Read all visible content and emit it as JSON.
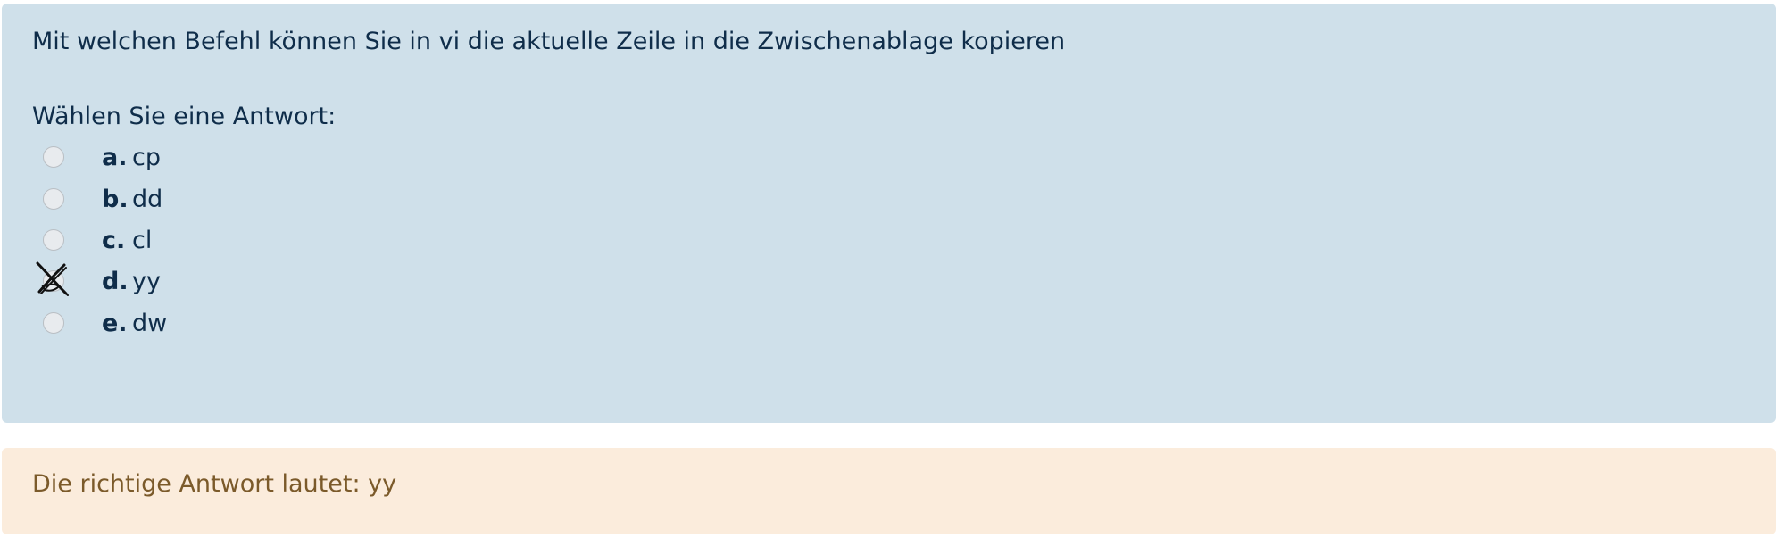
{
  "question": {
    "text": "Mit welchen Befehl können Sie in vi die aktuelle Zeile in die Zwischenablage kopieren",
    "prompt": "Wählen Sie eine Antwort:",
    "options": [
      {
        "letter": "a.",
        "text": "cp",
        "selected": false
      },
      {
        "letter": "b.",
        "text": "dd",
        "selected": false
      },
      {
        "letter": "c.",
        "text": "cl",
        "selected": false
      },
      {
        "letter": "d.",
        "text": "yy",
        "selected": true
      },
      {
        "letter": "e.",
        "text": "dw",
        "selected": false
      }
    ]
  },
  "feedback": {
    "text": "Die richtige Antwort lautet: yy"
  },
  "colors": {
    "question_bg": "#cfe0ea",
    "question_text": "#0f2d4a",
    "feedback_bg": "#fbecdc",
    "feedback_text": "#7b5a2a"
  },
  "icons": {
    "selection_mark": "hand-drawn-cross-icon"
  }
}
